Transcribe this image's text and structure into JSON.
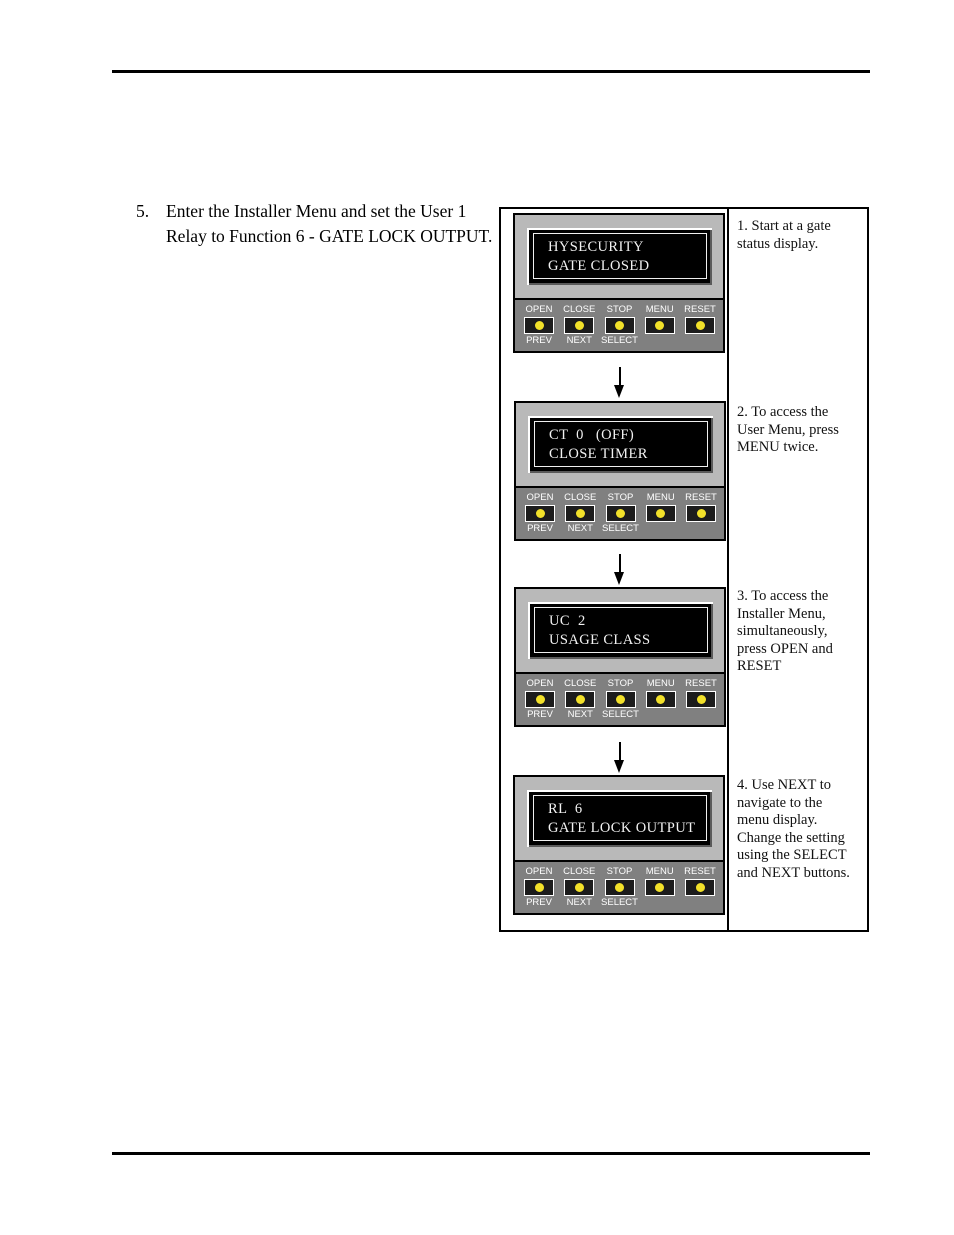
{
  "page": {
    "rules": [
      "top-rule",
      "bottom-rule"
    ]
  },
  "instruction": {
    "number": "5.",
    "text": "Enter the Installer Menu and set the User 1 Relay to Function 6 - GATE LOCK OUTPUT."
  },
  "figure": {
    "keypad_keys": [
      {
        "top": "OPEN",
        "bottom": "PREV"
      },
      {
        "top": "CLOSE",
        "bottom": "NEXT"
      },
      {
        "top": "STOP",
        "bottom": "SELECT"
      },
      {
        "top": "MENU",
        "bottom": ""
      },
      {
        "top": "RESET",
        "bottom": ""
      }
    ],
    "panels": [
      {
        "id": "panel-1",
        "lcd_line1": "HYSECURITY",
        "lcd_line2": "GATE CLOSED",
        "caption": "1. Start at a gate status display."
      },
      {
        "id": "panel-2",
        "lcd_line1": "CT  0   (OFF)",
        "lcd_line2": "CLOSE TIMER",
        "caption": "2. To access the User Menu, press MENU twice."
      },
      {
        "id": "panel-3",
        "lcd_line1": "UC  2",
        "lcd_line2": "USAGE CLASS",
        "caption": "3. To access the Installer Menu, simultaneously, press OPEN and RESET"
      },
      {
        "id": "panel-4",
        "lcd_line1": "RL  6",
        "lcd_line2": "GATE LOCK OUTPUT",
        "caption": "4. Use NEXT to navigate to the menu display. Change the setting using the SELECT and NEXT buttons."
      }
    ]
  },
  "colors": {
    "panel_body": "#808080",
    "panel_screen_area": "#b9b9b9",
    "lcd_background": "#000000",
    "lcd_text": "#f2f2f2",
    "led_yellow": "#f2e12a",
    "key_label": "#ffffff",
    "ink": "#000000"
  }
}
